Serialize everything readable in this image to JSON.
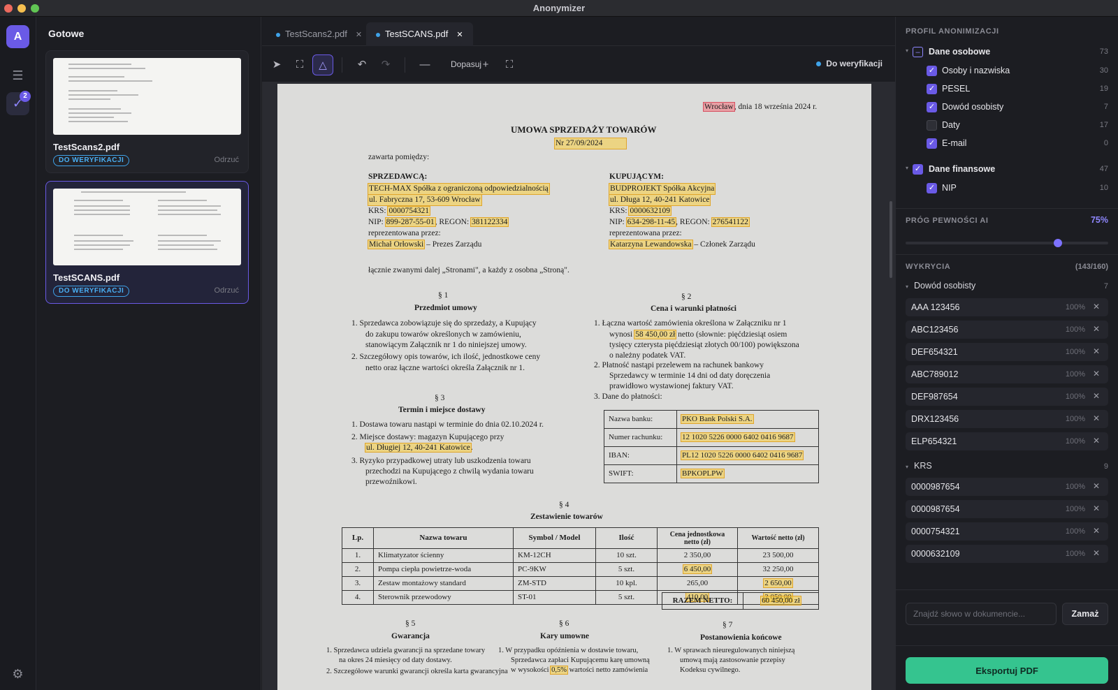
{
  "window": {
    "title": "Anonymizer"
  },
  "rail": {
    "avatar": "A",
    "badge": "2"
  },
  "files": {
    "heading": "Gotowe",
    "items": [
      {
        "name": "TestScans2.pdf",
        "tag": "DO WERYFIKACJI",
        "reject": "Odrzuć"
      },
      {
        "name": "TestSCANS.pdf",
        "tag": "DO WERYFIKACJI",
        "reject": "Odrzuć"
      }
    ]
  },
  "tabs": [
    {
      "label": "TestScans2.pdf"
    },
    {
      "label": "TestSCANS.pdf"
    }
  ],
  "toolbar": {
    "fit": "Dopasuj",
    "status": "Do weryfikacji"
  },
  "doc": {
    "date_place": "Wrocław",
    "date_rest": ", dnia 18 września 2024 r.",
    "title": "UMOWA SPRZEDAŻY TOWARÓW",
    "number": "Nr 27/09/2024",
    "between": "zawarta pomiędzy:",
    "seller_h": "SPRZEDAWCĄ:",
    "seller_name": "TECH-MAX Spółka z ograniczoną odpowiedzialnością",
    "seller_addr": "ul. Fabryczna 17, 53-609 Wrocław",
    "krs_l": "KRS: ",
    "seller_krs": "0000754321",
    "nip_l": "NIP: ",
    "seller_nip": "899-287-55-01",
    "regon_l": ", REGON: ",
    "seller_regon": "381122334",
    "rep": "reprezentowana przez:",
    "seller_rep": "Michał Orłowski",
    "seller_role": " – Prezes Zarządu",
    "buyer_h": "KUPUJĄCYM:",
    "buyer_name": "BUDPROJEKT Spółka Akcyjna",
    "buyer_addr": "ul. Długa 12, 40-241 Katowice",
    "buyer_krs": "0000632109",
    "buyer_nip": "634-298-11-45",
    "buyer_regon": "276541122",
    "buyer_rep": "Katarzyna Lewandowska",
    "buyer_role": " – Członek Zarządu",
    "parties": "łącznie zwanymi dalej „Stronami\", a każdy z osobna „Stroną\".",
    "s1": "§ 1",
    "s1t": "Przedmiot umowy",
    "s1_1": "1.   Sprzedawca zobowiązuje się do sprzedaży, a Kupujący",
    "s1_1b": "do zakupu towarów określonych w zamówieniu,",
    "s1_1c": "stanowiącym Załącznik nr 1 do niniejszej umowy.",
    "s1_2": "2.   Szczegółowy opis towarów, ich ilość, jednostkowe ceny",
    "s1_2b": "netto oraz łączne wartości określa Załącznik nr 1.",
    "s2": "§ 2",
    "s2t": "Cena i warunki płatności",
    "s2_1": "1.   Łączna wartość zamówienia określona w Załączniku nr 1",
    "s2_1b": "wynosi ",
    "s2_amount": "58 450,00 zł",
    "s2_1c": " netto (słownie: pięćdziesiąt osiem",
    "s2_1d": "tysięcy czterysta pięćdziesiąt złotych 00/100) powiększona",
    "s2_1e": "o należny podatek VAT.",
    "s2_2": "2.   Płatność nastąpi przelewem na rachunek bankowy",
    "s2_2b": "Sprzedawcy w terminie 14 dni od daty doręczenia",
    "s2_2c": "prawidłowo wystawionej faktury VAT.",
    "s2_3": "3.   Dane do płatności:",
    "bank": [
      {
        "k": "Nazwa banku:",
        "v": "PKO Bank Polski S.A."
      },
      {
        "k": "Numer rachunku:",
        "v": "12 1020 5226 0000 6402 0416 9687"
      },
      {
        "k": "IBAN:",
        "v": "PL12 1020 5226 0000 6402 0416 9687"
      },
      {
        "k": "SWIFT:",
        "v": "BPKOPLPW"
      }
    ],
    "s3": "§ 3",
    "s3t": "Termin i miejsce dostawy",
    "s3_1": "1.   Dostawa towaru nastąpi w terminie do dnia 02.10.2024 r.",
    "s3_2": "2.   Miejsce dostawy: magazyn Kupującego przy",
    "s3_2addr": "ul. Długiej 12, 40-241 Katowice",
    "s3_3": "3.   Ryzyko przypadkowej utraty lub uszkodzenia towaru",
    "s3_3b": "przechodzi na Kupującego z chwilą wydania towaru",
    "s3_3c": "przewoźnikowi.",
    "s4": "§ 4",
    "s4t": "Zestawienie towarów",
    "goods_head": [
      "Lp.",
      "Nazwa towaru",
      "Symbol / Model",
      "Ilość",
      "Cena jednostkowa netto (zł)",
      "Wartość netto (zł)"
    ],
    "goods": [
      [
        "1.",
        "Klimatyzator ścienny",
        "KM-12CH",
        "10 szt.",
        "2 350,00",
        "23 500,00"
      ],
      [
        "2.",
        "Pompa ciepła powietrze-woda",
        "PC-9KW",
        "5 szt.",
        "6 450,00",
        "32 250,00"
      ],
      [
        "3.",
        "Zestaw montażowy standard",
        "ZM-STD",
        "10 kpl.",
        "265,00",
        "2 650,00"
      ],
      [
        "4.",
        "Sterownik przewodowy",
        "ST-01",
        "5 szt.",
        "410,00",
        "2 050,00"
      ]
    ],
    "total_l": "RAZEM NETTO:",
    "total": "60 450,00 zł",
    "s5": "§ 5",
    "s5t": "Gwarancja",
    "s5_1": "1.   Sprzedawca udziela gwarancji na sprzedane towary",
    "s5_1b": "na okres 24 miesięcy od daty dostawy.",
    "s5_2": "2.   Szczegółowe warunki gwarancji określa karta gwarancyjna",
    "s6": "§ 6",
    "s6t": "Kary umowne",
    "s6_1": "1.   W przypadku opóźnienia w dostawie towaru,",
    "s6_1b": "Sprzedawca zapłaci Kupującemu karę umowną",
    "s6_1c": "w wysokości ",
    "s6_pct": "0,5%",
    "s6_1d": " wartości netto zamówienia",
    "s7": "§ 7",
    "s7t": "Postanowienia końcowe",
    "s7_1": "1.   W sprawach nieuregulowanych niniejszą",
    "s7_1b": "umową mają zastosowanie przepisy",
    "s7_1c": "Kodeksu cywilnego."
  },
  "profile": {
    "heading": "PROFIL ANONIMIZACJI",
    "groups": [
      {
        "label": "Dane osobowe",
        "count": "73",
        "items": [
          {
            "label": "Osoby i nazwiska",
            "count": "30"
          },
          {
            "label": "PESEL",
            "count": "19"
          },
          {
            "label": "Dowód osobisty",
            "count": "7"
          },
          {
            "label": "Daty",
            "count": "17"
          },
          {
            "label": "E-mail",
            "count": "0"
          }
        ]
      },
      {
        "label": "Dane finansowe",
        "count": "47",
        "items": [
          {
            "label": "NIP",
            "count": "10"
          }
        ]
      }
    ]
  },
  "threshold": {
    "heading": "PRÓG PEWNOŚCI AI",
    "value": "75%",
    "level": 0.75
  },
  "detections": {
    "heading": "WYKRYCIA",
    "count": "(143/160)",
    "groups": [
      {
        "label": "Dowód osobisty",
        "count": "7",
        "items": [
          "AAA 123456",
          "ABC123456",
          "DEF654321",
          "ABC789012",
          "DEF987654",
          "DRX123456",
          "ELP654321"
        ]
      },
      {
        "label": "KRS",
        "count": "9",
        "items": [
          "0000987654",
          "0000987654",
          "0000754321",
          "0000632109"
        ]
      }
    ],
    "pct": "100%"
  },
  "search": {
    "placeholder": "Znajdź słowo w dokumencie...",
    "button": "Zamaż"
  },
  "export": {
    "label": "Eksportuj PDF"
  }
}
